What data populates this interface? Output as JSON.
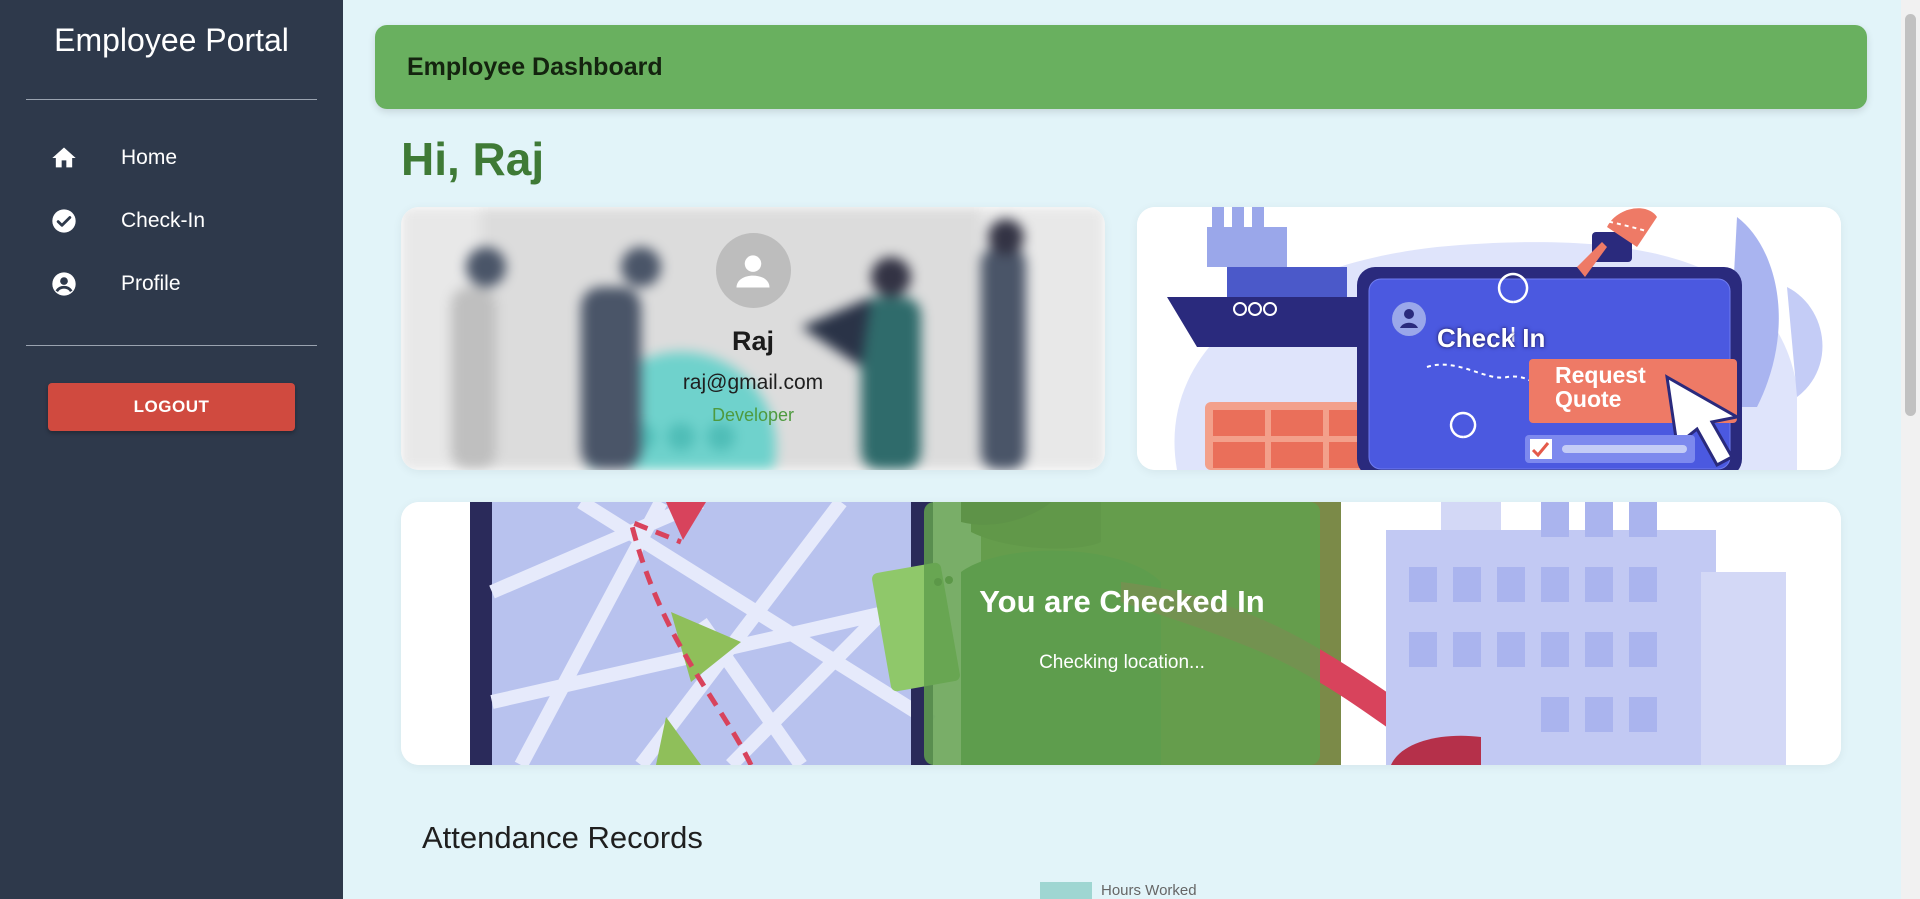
{
  "sidebar": {
    "brand": "Employee Portal",
    "items": [
      {
        "label": "Home",
        "icon": "home-icon"
      },
      {
        "label": "Check-In",
        "icon": "check-circle-icon"
      },
      {
        "label": "Profile",
        "icon": "account-circle-icon"
      }
    ],
    "logout_label": "LOGOUT"
  },
  "header": {
    "title": "Employee Dashboard"
  },
  "greeting": "Hi, Raj",
  "profile": {
    "name": "Raj",
    "email": "raj@gmail.com",
    "role": "Developer"
  },
  "checkin_card": {
    "title": "Check In",
    "cta": "Request Quote"
  },
  "status": {
    "title": "You are Checked In",
    "subtitle": "Checking location..."
  },
  "attendance": {
    "title": "Attendance Records",
    "legend_label": "Hours Worked"
  },
  "colors": {
    "sidebar_bg": "#2e394b",
    "accent_green": "#69b05f",
    "greeting_green": "#3f7a36",
    "logout_red": "#d04a3f",
    "page_bg": "#e2f4f9"
  }
}
